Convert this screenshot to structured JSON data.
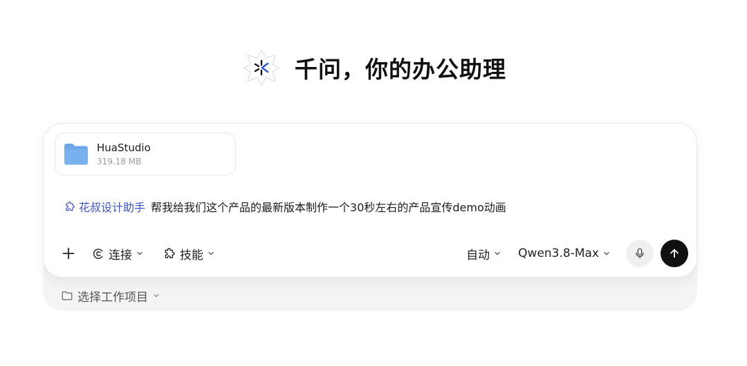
{
  "header": {
    "title": "千问，你的办公助理"
  },
  "attachment": {
    "name": "HuaStudio",
    "size": "319.18 MB",
    "icon": "folder-icon",
    "color": "#6aa7ea"
  },
  "prompt": {
    "skill_tag": "花叔设计助手",
    "text": "帮我给我们这个产品的最新版本制作一个30秒左右的产品宣传demo动画",
    "accent": "#3a52c8"
  },
  "toolbar": {
    "connect_label": "连接",
    "skills_label": "技能",
    "mode_label": "自动",
    "model_label": "Qwen3.8-Max"
  },
  "project": {
    "label": "选择工作项目"
  }
}
